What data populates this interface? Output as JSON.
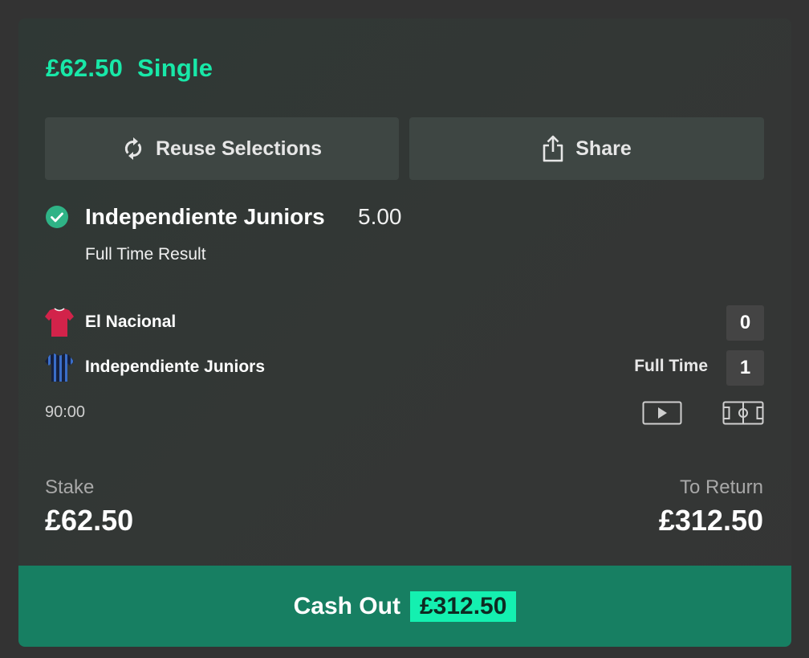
{
  "bet": {
    "stake_header": "£62.50",
    "type": "Single"
  },
  "actions": {
    "reuse_label": "Reuse Selections",
    "share_label": "Share"
  },
  "selection": {
    "name": "Independiente Juniors",
    "odds": "5.00",
    "market": "Full Time Result",
    "status_icon": "check-circle-icon"
  },
  "match": {
    "home": {
      "name": "El Nacional",
      "score": "0",
      "shirt_color": "#d2234a"
    },
    "away": {
      "name": "Independiente Juniors",
      "score": "1",
      "shirt_color": "#1a2c5c"
    },
    "status": "Full Time",
    "clock": "90:00",
    "icons": [
      "video-icon",
      "pitch-icon"
    ]
  },
  "summary": {
    "stake_label": "Stake",
    "stake_value": "£62.50",
    "return_label": "To Return",
    "return_value": "£312.50"
  },
  "cashout": {
    "label": "Cash Out",
    "amount": "£312.50"
  },
  "colors": {
    "accent": "#18e8a8",
    "cashout_bg": "#177f62",
    "cashout_badge": "#14f0b0",
    "button_bg": "#3e4643"
  }
}
